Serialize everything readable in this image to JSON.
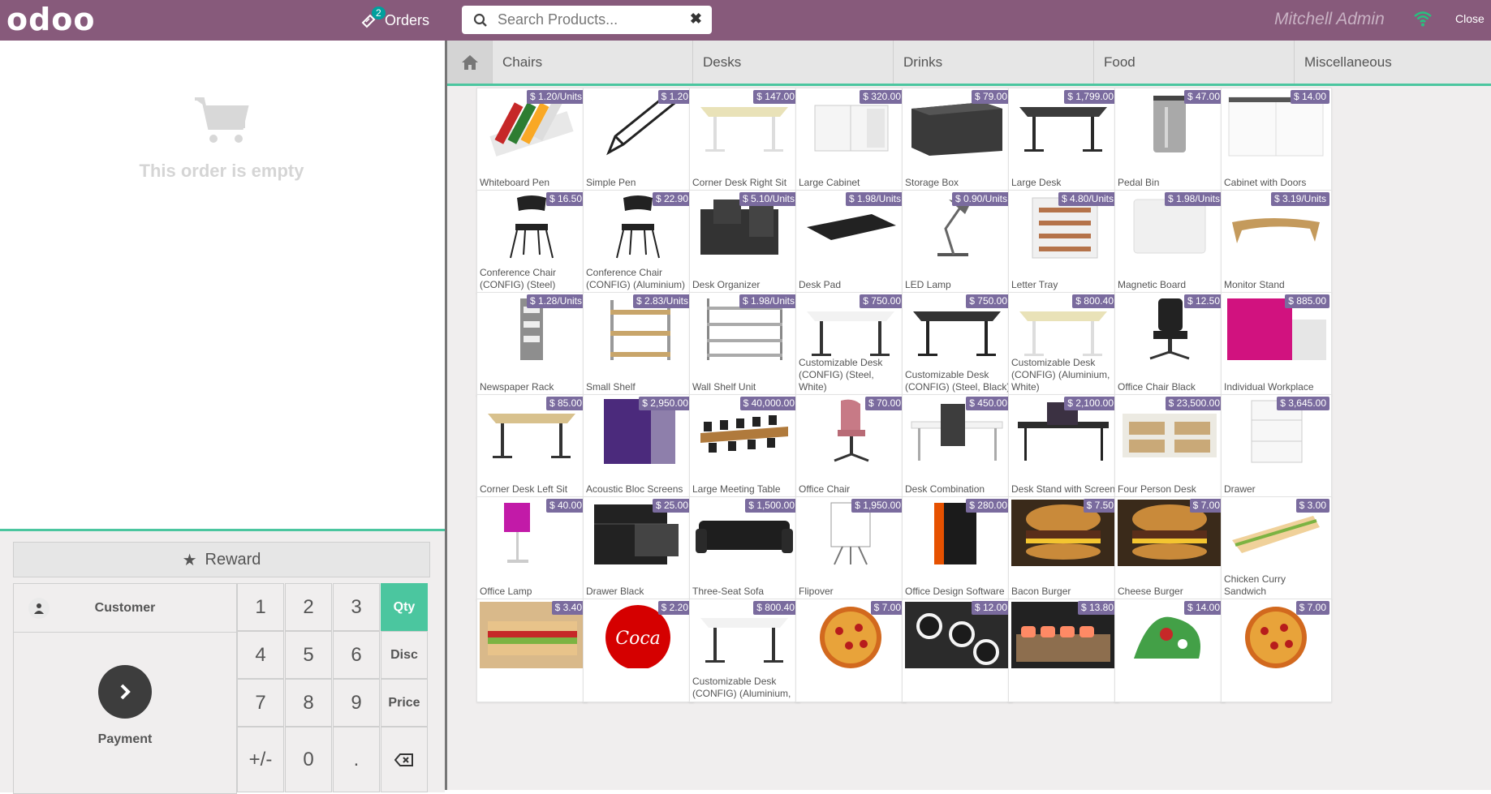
{
  "header": {
    "logo": "odoo",
    "orders_label": "Orders",
    "orders_count": "2",
    "search_placeholder": "Search Products...",
    "user": "Mitchell Admin",
    "close_label": "Close"
  },
  "order": {
    "empty_text": "This order is empty"
  },
  "controls": {
    "reward_label": "Reward",
    "customer_label": "Customer",
    "payment_label": "Payment",
    "keys": [
      "1",
      "2",
      "3",
      "Qty",
      "4",
      "5",
      "6",
      "Disc",
      "7",
      "8",
      "9",
      "Price",
      "+/-",
      "0",
      "."
    ],
    "active_mode": "Qty"
  },
  "categories": [
    "Chairs",
    "Desks",
    "Drinks",
    "Food",
    "Miscellaneous"
  ],
  "products": [
    {
      "name": "Whiteboard Pen",
      "price": "$ 1.20/Units",
      "icon": "pens"
    },
    {
      "name": "Simple Pen",
      "price": "$ 1.20",
      "icon": "pen"
    },
    {
      "name": "Corner Desk Right Sit",
      "price": "$ 147.00",
      "icon": "desk-corner"
    },
    {
      "name": "Large Cabinet",
      "price": "$ 320.00",
      "icon": "cabinet"
    },
    {
      "name": "Storage Box",
      "price": "$ 79.00",
      "icon": "box"
    },
    {
      "name": "Large Desk",
      "price": "$ 1,799.00",
      "icon": "desk-dark"
    },
    {
      "name": "Pedal Bin",
      "price": "$ 47.00",
      "icon": "bin"
    },
    {
      "name": "Cabinet with Doors",
      "price": "$ 14.00",
      "icon": "cabinet-white"
    },
    {
      "name": "Conference Chair (CONFIG) (Steel)",
      "price": "$ 16.50",
      "icon": "chair"
    },
    {
      "name": "Conference Chair (CONFIG) (Aluminium)",
      "price": "$ 22.90",
      "icon": "chair"
    },
    {
      "name": "Desk Organizer",
      "price": "$ 5.10/Units",
      "icon": "organizer"
    },
    {
      "name": "Desk Pad",
      "price": "$ 1.98/Units",
      "icon": "pad"
    },
    {
      "name": "LED Lamp",
      "price": "$ 0.90/Units",
      "icon": "lamp"
    },
    {
      "name": "Letter Tray",
      "price": "$ 4.80/Units",
      "icon": "tray"
    },
    {
      "name": "Magnetic Board",
      "price": "$ 1.98/Units",
      "icon": "board"
    },
    {
      "name": "Monitor Stand",
      "price": "$ 3.19/Units",
      "icon": "stand"
    },
    {
      "name": "Newspaper Rack",
      "price": "$ 1.28/Units",
      "icon": "rack"
    },
    {
      "name": "Small Shelf",
      "price": "$ 2.83/Units",
      "icon": "shelf"
    },
    {
      "name": "Wall Shelf Unit",
      "price": "$ 1.98/Units",
      "icon": "wallshelf"
    },
    {
      "name": "Customizable Desk (CONFIG) (Steel, White)",
      "price": "$ 750.00",
      "icon": "desk-white"
    },
    {
      "name": "Customizable Desk (CONFIG) (Steel, Black)",
      "price": "$ 750.00",
      "icon": "desk-black"
    },
    {
      "name": "Customizable Desk (CONFIG) (Aluminium, White)",
      "price": "$ 800.40",
      "icon": "desk-corner"
    },
    {
      "name": "Office Chair Black",
      "price": "$ 12.50",
      "icon": "office-chair"
    },
    {
      "name": "Individual Workplace",
      "price": "$ 885.00",
      "icon": "pod"
    },
    {
      "name": "Corner Desk Left Sit",
      "price": "$ 85.00",
      "icon": "desk-wood"
    },
    {
      "name": "Acoustic Bloc Screens",
      "price": "$ 2,950.00",
      "icon": "screen"
    },
    {
      "name": "Large Meeting Table",
      "price": "$ 40,000.00",
      "icon": "meeting"
    },
    {
      "name": "Office Chair",
      "price": "$ 70.00",
      "icon": "pink-chair"
    },
    {
      "name": "Desk Combination",
      "price": "$ 450.00",
      "icon": "desk-combo"
    },
    {
      "name": "Desk Stand with Screen",
      "price": "$ 2,100.00",
      "icon": "desk-screen"
    },
    {
      "name": "Four Person Desk",
      "price": "$ 23,500.00",
      "icon": "four-desk"
    },
    {
      "name": "Drawer",
      "price": "$ 3,645.00",
      "icon": "drawer"
    },
    {
      "name": "Office Lamp",
      "price": "$ 40.00",
      "icon": "office-lamp"
    },
    {
      "name": "Drawer Black",
      "price": "$ 25.00",
      "icon": "drawer-black"
    },
    {
      "name": "Three-Seat Sofa",
      "price": "$ 1,500.00",
      "icon": "sofa"
    },
    {
      "name": "Flipover",
      "price": "$ 1,950.00",
      "icon": "flipover"
    },
    {
      "name": "Office Design Software",
      "price": "$ 280.00",
      "icon": "software"
    },
    {
      "name": "Bacon Burger",
      "price": "$ 7.50",
      "icon": "burger"
    },
    {
      "name": "Cheese Burger",
      "price": "$ 7.00",
      "icon": "burger"
    },
    {
      "name": "Chicken Curry Sandwich",
      "price": "$ 3.00",
      "icon": "sandwich"
    },
    {
      "name": "",
      "price": "$ 3.40",
      "icon": "sandwich2"
    },
    {
      "name": "",
      "price": "$ 2.20",
      "icon": "coke"
    },
    {
      "name": "Customizable Desk (CONFIG) (Aluminium,",
      "price": "$ 800.40",
      "icon": "desk-white"
    },
    {
      "name": "",
      "price": "$ 7.00",
      "icon": "pizza"
    },
    {
      "name": "",
      "price": "$ 12.00",
      "icon": "sushi-roll"
    },
    {
      "name": "",
      "price": "$ 13.80",
      "icon": "sushi"
    },
    {
      "name": "",
      "price": "$ 14.00",
      "icon": "salad"
    },
    {
      "name": "",
      "price": "$ 7.00",
      "icon": "pizza"
    }
  ]
}
